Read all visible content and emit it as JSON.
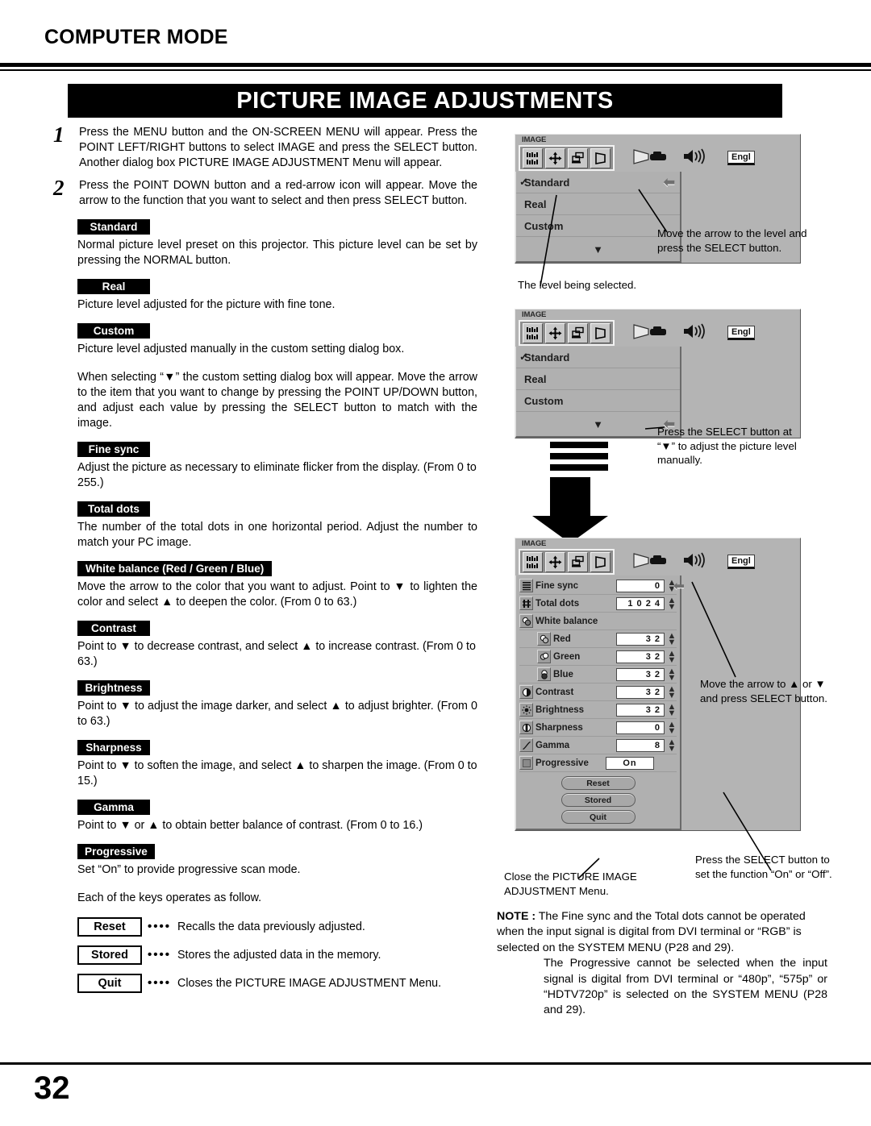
{
  "header": {
    "mode_title": "COMPUTER MODE",
    "banner_title": "PICTURE IMAGE ADJUSTMENTS"
  },
  "steps": [
    {
      "num": "1",
      "text": "Press the MENU button and the ON-SCREEN MENU will appear.  Press the POINT LEFT/RIGHT buttons to select IMAGE and press the SELECT button.  Another dialog box PICTURE IMAGE ADJUSTMENT Menu will appear."
    },
    {
      "num": "2",
      "text": "Press the POINT DOWN button and a red-arrow icon will appear.  Move the arrow to the function that you want to select and then press SELECT button."
    }
  ],
  "sections": [
    {
      "badge": "Standard",
      "body": "Normal picture level preset on this projector.  This picture level can be set by pressing the NORMAL button."
    },
    {
      "badge": "Real",
      "body": "Picture level adjusted for the picture with fine tone."
    },
    {
      "badge": "Custom",
      "body": "Picture level adjusted manually in the custom setting dialog box."
    },
    {
      "badge": "Fine sync",
      "body": "Adjust the picture as necessary to eliminate flicker from the display. (From 0 to 255.)"
    },
    {
      "badge": "Total dots",
      "body": "The number of the total dots in one horizontal period.  Adjust the number to match your PC image."
    },
    {
      "badge": "White balance (Red / Green / Blue)",
      "body": "Move the arrow to the color that you want to adjust.  Point to ▼ to lighten the color and select ▲ to deepen the color. (From 0 to 63.)"
    },
    {
      "badge": "Contrast",
      "body": "Point to ▼ to decrease contrast, and select ▲ to increase contrast. (From 0 to 63.)"
    },
    {
      "badge": "Brightness",
      "body": "Point to ▼ to adjust the image darker, and select ▲ to adjust brighter. (From 0 to 63.)"
    },
    {
      "badge": "Sharpness",
      "body": "Point to ▼ to soften the image, and select ▲ to sharpen the image. (From 0 to 15.)"
    },
    {
      "badge": "Gamma",
      "body": "Point to ▼ or ▲ to obtain better balance of contrast. (From 0 to 16.)"
    },
    {
      "badge": "Progressive",
      "body": "Set “On” to provide progressive scan mode."
    }
  ],
  "custom_para": "When selecting “▼” the custom setting dialog box will appear.  Move the arrow to the item that you want to change by pressing the POINT UP/DOWN button, and adjust each value by pressing the SELECT button to match with the image.",
  "keys_intro": "Each of the keys operates as follow.",
  "keys": [
    {
      "label": "Reset",
      "dots": "••••",
      "desc": "Recalls the data previously adjusted."
    },
    {
      "label": "Stored",
      "dots": "••••",
      "desc": "Stores the adjusted data in the memory."
    },
    {
      "label": "Quit",
      "dots": "••••",
      "desc": "Closes the PICTURE IMAGE ADJUSTMENT Menu."
    }
  ],
  "osd": {
    "window_title": "IMAGE",
    "language_value": "Engl",
    "toolbar_icons": [
      "image-adjust-icon",
      "position-move-icon",
      "pc-adjust-icon",
      "keystone-icon"
    ],
    "status_icons": [
      "projector-icon",
      "volume-icon"
    ],
    "menu_items": [
      {
        "label": "Standard",
        "checked": true
      },
      {
        "label": "Real",
        "checked": false
      },
      {
        "label": "Custom",
        "checked": false
      }
    ],
    "more_arrow": "▼",
    "adjust_rows": [
      {
        "icon": "fine-sync-icon",
        "label": "Fine sync",
        "value": "0",
        "indent": false,
        "spinner": true
      },
      {
        "icon": "total-dots-icon",
        "label": "Total dots",
        "value": "1 0 2 4",
        "indent": false,
        "spinner": true
      },
      {
        "icon": "white-balance-icon",
        "label": "White balance",
        "value": "",
        "indent": false,
        "spinner": false
      },
      {
        "icon": "red-icon",
        "label": "Red",
        "value": "3 2",
        "indent": true,
        "spinner": true
      },
      {
        "icon": "green-icon",
        "label": "Green",
        "value": "3 2",
        "indent": true,
        "spinner": true
      },
      {
        "icon": "blue-icon",
        "label": "Blue",
        "value": "3 2",
        "indent": true,
        "spinner": true
      },
      {
        "icon": "contrast-icon",
        "label": "Contrast",
        "value": "3 2",
        "indent": false,
        "spinner": true
      },
      {
        "icon": "brightness-icon",
        "label": "Brightness",
        "value": "3 2",
        "indent": false,
        "spinner": true
      },
      {
        "icon": "sharpness-icon",
        "label": "Sharpness",
        "value": "0",
        "indent": false,
        "spinner": true
      },
      {
        "icon": "gamma-icon",
        "label": "Gamma",
        "value": "8",
        "indent": false,
        "spinner": true
      },
      {
        "icon": "progressive-icon",
        "label": "Progressive",
        "value": "On",
        "indent": false,
        "spinner": false
      }
    ],
    "buttons": [
      "Reset",
      "Stored",
      "Quit"
    ]
  },
  "annotations": {
    "move_arrow_level": "Move the arrow to the level and press the SELECT button.",
    "level_being_selected": "The level being selected.",
    "press_select_custom": "Press the SELECT button at “▼” to adjust the picture level manually.",
    "move_arrow_updown": "Move the arrow to ▲ or ▼  and press SELECT button.",
    "close_menu": "Close the PICTURE IMAGE ADJUSTMENT Menu.",
    "press_select_onoff": "Press the SELECT button to set the function “On” or “Off”."
  },
  "note": {
    "label": "NOTE :",
    "paragraph1": "The Fine sync and the Total dots cannot be operated when the input signal is digital from DVI terminal or “RGB” is selected on the SYSTEM MENU (P28 and 29).",
    "paragraph2": "The Progressive cannot be selected  when the input signal is digital from DVI terminal or “480p”, “575p” or “HDTV720p”  is selected on the SYSTEM MENU (P28 and 29)."
  },
  "footer": {
    "page_number": "32"
  }
}
